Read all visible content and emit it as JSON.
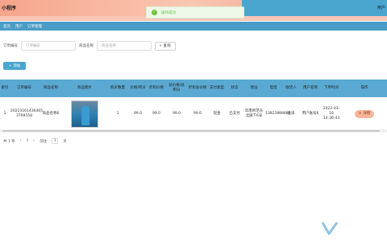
{
  "header": {
    "title": "小程序",
    "corner": "用户",
    "toast": "操作成功"
  },
  "tabs": [
    "首页",
    "用户",
    "订单管理"
  ],
  "search": {
    "order_label": "订单编号",
    "order_placeholder": "订单编号",
    "product_label": "商品名称",
    "product_placeholder": "商品名称",
    "search_button": "查询"
  },
  "add_button": "添加",
  "table": {
    "headers": [
      "索引",
      "订单编号",
      "商品名称",
      "商品图片",
      "购买数量",
      "价格/积分",
      "折扣价格",
      "总价格/总积分",
      "折扣总价格",
      "支付类型",
      "状态",
      "地址",
      "电话",
      "收货人",
      "用户名称",
      "下单时间",
      "操作"
    ],
    "rows": [
      [
        "1",
        "20223161436405 3769558",
        "商品名称6",
        "",
        "1",
        "99.0",
        "99.0",
        "99.0",
        "99.0",
        "现金",
        "已支付",
        "华南师范东北旗下6号",
        "13823888881",
        "金溪",
        "用户账号6",
        "2022-03-16 14:36:43",
        "详情"
      ]
    ]
  },
  "pager": {
    "total": "共 1 条",
    "page": "1",
    "goto_label": "前往",
    "goto_value": "1",
    "page_unit": "页"
  }
}
